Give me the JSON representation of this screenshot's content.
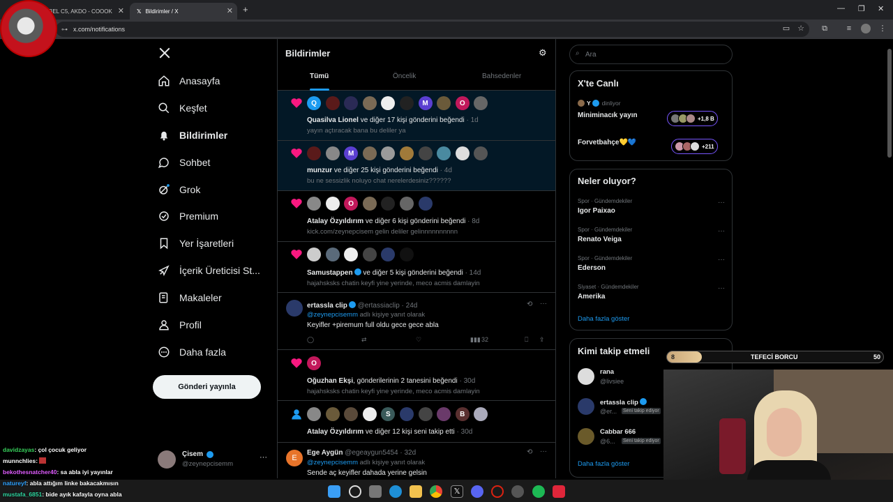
{
  "browser": {
    "tabs": [
      {
        "label": "BEL C5, AKDO - COOOK",
        "active": false
      },
      {
        "label": "Bildirimler / X",
        "active": true
      }
    ],
    "url": "x.com/notifications"
  },
  "sidebar": {
    "items": [
      {
        "label": "Anasayfa",
        "icon": "home-icon"
      },
      {
        "label": "Keşfet",
        "icon": "search-icon"
      },
      {
        "label": "Bildirimler",
        "icon": "bell-icon",
        "active": true
      },
      {
        "label": "Sohbet",
        "icon": "chat-icon"
      },
      {
        "label": "Grok",
        "icon": "grok-icon"
      },
      {
        "label": "Premium",
        "icon": "premium-icon"
      },
      {
        "label": "Yer İşaretleri",
        "icon": "bookmark-icon"
      },
      {
        "label": "İçerik Üreticisi St...",
        "icon": "rocket-icon"
      },
      {
        "label": "Makaleler",
        "icon": "article-icon"
      },
      {
        "label": "Profil",
        "icon": "person-icon"
      },
      {
        "label": "Daha fazla",
        "icon": "more-circle-icon"
      }
    ],
    "post_button": "Gönderi yayınla",
    "account": {
      "name": "Çisem",
      "handle": "@zeynepcisemm"
    }
  },
  "main": {
    "title": "Bildirimler",
    "tabs": [
      "Tümü",
      "Öncelik",
      "Bahsedenler"
    ],
    "notifications": [
      {
        "kind": "like",
        "name": "Quasilva Lionel",
        "text": " ve diğer 17 kişi gönderini beğendi",
        "time": "· 1d",
        "sub": "yayın açtıracak bana bu deliler ya",
        "avatars": [
          "Q",
          "",
          "",
          "",
          "",
          "",
          "M",
          "O",
          ""
        ]
      },
      {
        "kind": "like",
        "name": "munzur",
        "text": " ve diğer 25 kişi gönderini beğendi",
        "time": "· 4d",
        "sub": "bu ne sessizlik noluyo chat nerelerdesiniz??????",
        "avatars": [
          "",
          "",
          "M",
          "",
          "",
          "",
          "",
          "",
          "",
          ""
        ]
      },
      {
        "kind": "like",
        "name": "Atalay Özyıldırım",
        "text": " ve diğer 6 kişi gönderini beğendi",
        "time": "· 8d",
        "sub": "kick.com/zeynepcisem gelin deliler gelinnnnnnnnnn",
        "avatars": [
          "",
          "",
          "O",
          "",
          "",
          "",
          ""
        ]
      },
      {
        "kind": "like",
        "name": "Samustappen",
        "text": " ve diğer 5 kişi gönderini beğendi",
        "time": "· 14d",
        "sub": "hajahsksks chatin keyfi yine yerinde, meco acmis damlayin",
        "avatars": [
          "",
          "",
          "",
          "",
          "",
          ""
        ]
      },
      {
        "kind": "reply",
        "name": "ertassla clip",
        "handle": "@ertassiaclip",
        "time": "· 24d",
        "replying": "@zeynepcisemm",
        "replying_suffix": " adlı kişiye yanıt olarak",
        "body": "Keyifler +piremum full oldu gece gece abla",
        "views": "32"
      },
      {
        "kind": "like",
        "name": "Oğuzhan Ekşi",
        "text": ", gönderilerinin 2 tanesini beğendi",
        "time": "· 30d",
        "sub": "hajahsksks chatin keyfi yine yerinde, meco acmis damlayin",
        "avatars": [
          "O"
        ]
      },
      {
        "kind": "follow",
        "name": "Atalay Özyıldırım",
        "text": " ve diğer 12 kişi seni takip etti",
        "time": "· 30d",
        "avatars": [
          "",
          "",
          "",
          "",
          "S",
          "",
          "",
          "",
          "B",
          ""
        ]
      },
      {
        "kind": "reply",
        "name": "Ege Aygün",
        "handle": "@egeaygun5454",
        "time": "· 32d",
        "replying": "@zeynepcisemm",
        "replying_suffix": " adlı kişiye yanıt olarak",
        "body": "Sende aç keyifler dahada yerine gelsin",
        "avatar": "E"
      }
    ]
  },
  "right": {
    "search_placeholder": "Ara",
    "live": {
      "title": "X'te Canlı",
      "listener_name": "Y",
      "listener_suffix": "dinliyor",
      "rows": [
        {
          "title": "Miniminacık yayın",
          "count": "+1,8 B"
        },
        {
          "title": "Forvetbahçe💛💙",
          "count": "+211"
        }
      ]
    },
    "trends": {
      "title": "Neler oluyor?",
      "items": [
        {
          "category": "Spor · Gündemdekiler",
          "name": "Igor Paixao"
        },
        {
          "category": "Spor · Gündemdekiler",
          "name": "Renato Veiga"
        },
        {
          "category": "Spor · Gündemdekiler",
          "name": "Ederson"
        },
        {
          "category": "Siyaset · Gündemdekiler",
          "name": "Amerika"
        }
      ],
      "more": "Daha fazla göster"
    },
    "who_to_follow": {
      "title": "Kimi takip etmeli",
      "users": [
        {
          "name": "rana",
          "handle": "@livsiee",
          "badge": ""
        },
        {
          "name": "ertassla clip",
          "handle": "@er...",
          "badge": "Seni takip ediyor"
        },
        {
          "name": "Cabbar 666",
          "handle": "@6...",
          "badge": "Seni takip ediyor"
        }
      ],
      "more": "Daha fazla göster"
    }
  },
  "overlay": {
    "progress": {
      "label": "TEFECİ BORCU",
      "current": "8",
      "max": "50",
      "fraction": 0.16
    },
    "chat": [
      {
        "user": "davidzayas",
        "msg": ": çol çocuk geliyor",
        "color": "#38d15c"
      },
      {
        "user": "munnchlies",
        "msg": ": ",
        "color": "#ffffff"
      },
      {
        "user": "bekothesnatcher40",
        "msg": ": sa abla iyi yayınlar",
        "color": "#e05cff"
      },
      {
        "user": "natureyf",
        "msg": ": abla attığım linke bakacakmısın",
        "color": "#2fa3ff"
      },
      {
        "user": "mustafa_6851",
        "msg": ": bide ayık kafayla oyna abla",
        "color": "#2fd6a0"
      }
    ]
  },
  "colors": {
    "accent": "#1d9bf0",
    "like": "#f91880",
    "grok_purple": "#7856ff"
  }
}
